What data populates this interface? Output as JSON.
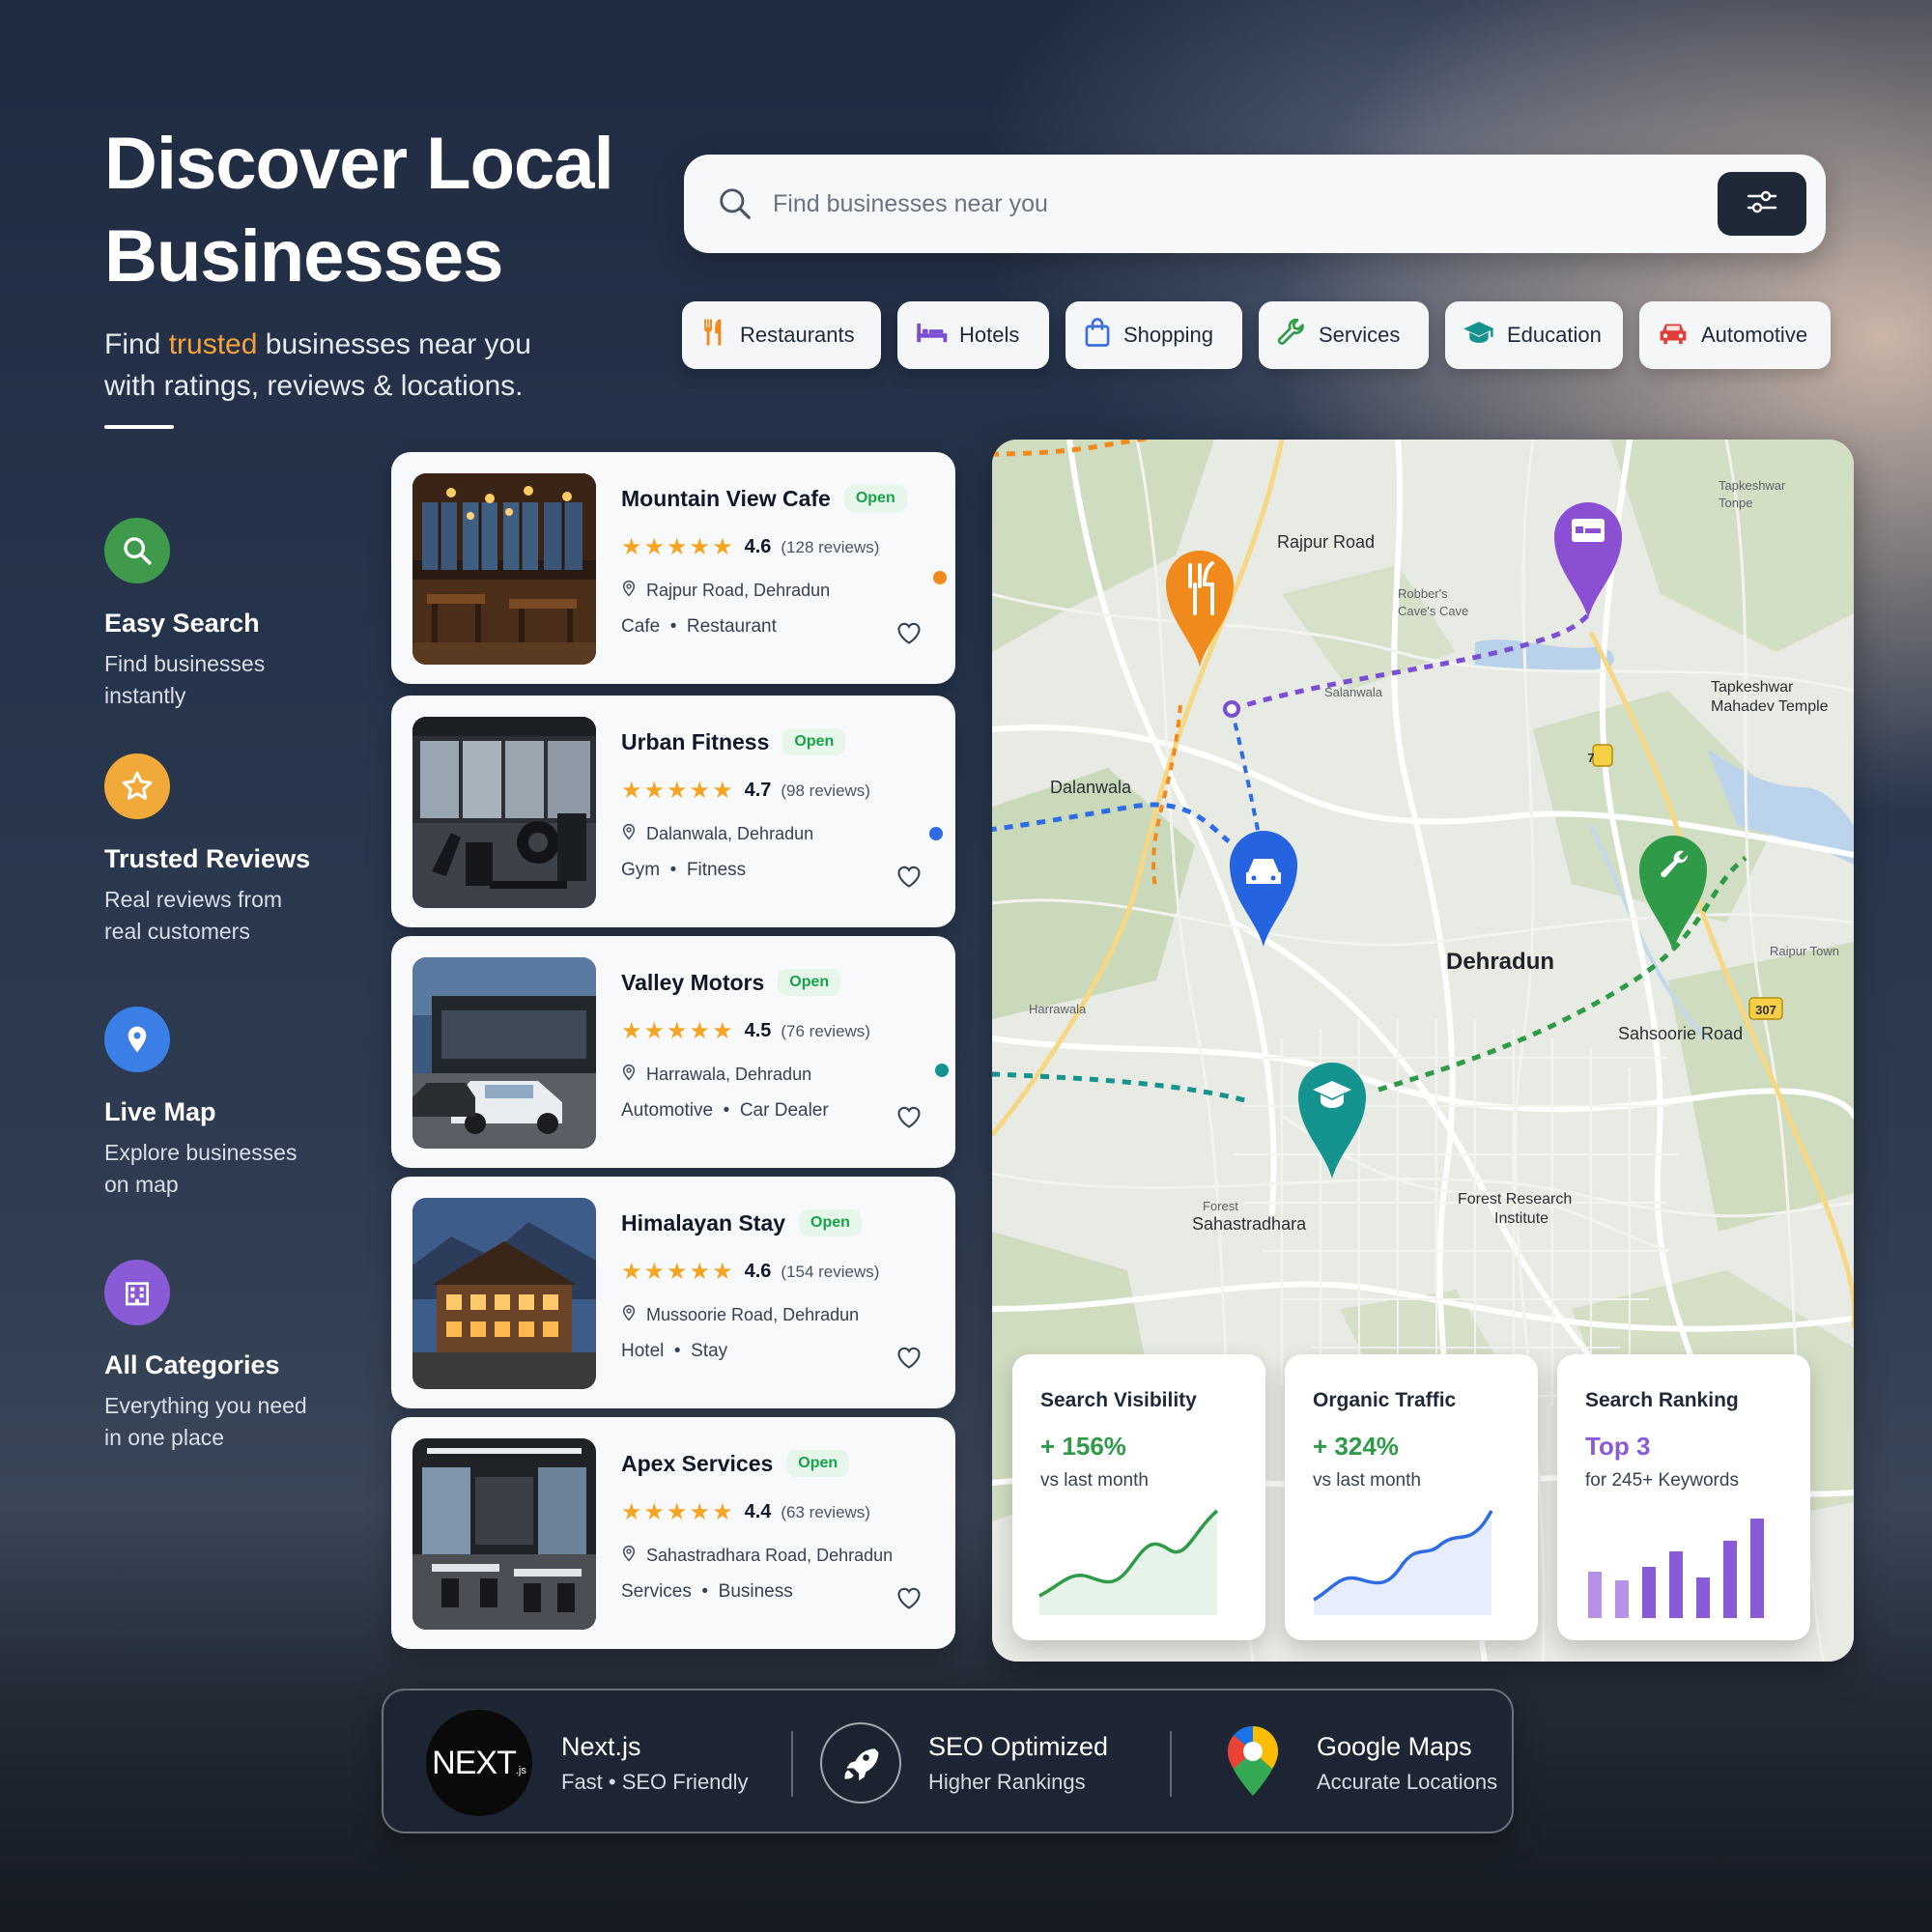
{
  "hero": {
    "title_line1": "Discover Local",
    "title_line2": "Businesses",
    "sub_pre": "Find ",
    "sub_highlight": "trusted",
    "sub_post": " businesses near you",
    "sub_line2": "with ratings, reviews & locations."
  },
  "features": [
    {
      "title": "Easy Search",
      "desc1": "Find businesses",
      "desc2": "instantly",
      "color": "#3f9a4c",
      "icon": "search-icon"
    },
    {
      "title": "Trusted Reviews",
      "desc1": "Real reviews from",
      "desc2": "real customers",
      "color": "#f1a93a",
      "icon": "star-icon"
    },
    {
      "title": "Live Map",
      "desc1": "Explore businesses",
      "desc2": "on map",
      "color": "#3b7fe6",
      "icon": "location-pin-icon"
    },
    {
      "title": "All Categories",
      "desc1": "Everything you need",
      "desc2": "in one place",
      "color": "#8a5bd6",
      "icon": "building-icon"
    }
  ],
  "search": {
    "placeholder": "Find businesses near you"
  },
  "categories": [
    {
      "label": "Restaurants",
      "icon": "fork-knife-icon",
      "color": "#f08a1c"
    },
    {
      "label": "Hotels",
      "icon": "bed-icon",
      "color": "#7b4fd3"
    },
    {
      "label": "Shopping",
      "icon": "shopping-bag-icon",
      "color": "#3b6fe0"
    },
    {
      "label": "Services",
      "icon": "wrench-icon",
      "color": "#2f9a48"
    },
    {
      "label": "Education",
      "icon": "graduation-cap-icon",
      "color": "#14938f"
    },
    {
      "label": "Automotive",
      "icon": "car-icon",
      "color": "#e0403a"
    }
  ],
  "listings": [
    {
      "name": "Mountain View Cafe",
      "status": "Open",
      "stars": "★★★★★",
      "rating": "4.6",
      "reviews": "(128 reviews)",
      "address": "Rajpur Road, Dehradun",
      "tag1": "Cafe",
      "tag2": "Restaurant"
    },
    {
      "name": "Urban Fitness",
      "status": "Open",
      "stars": "★★★★★",
      "rating": "4.7",
      "reviews": "(98 reviews)",
      "address": "Dalanwala, Dehradun",
      "tag1": "Gym",
      "tag2": "Fitness"
    },
    {
      "name": "Valley Motors",
      "status": "Open",
      "stars": "★★★★★",
      "rating": "4.5",
      "reviews": "(76 reviews)",
      "address": "Harrawala, Dehradun",
      "tag1": "Automotive",
      "tag2": "Car Dealer"
    },
    {
      "name": "Himalayan Stay",
      "status": "Open",
      "stars": "★★★★★",
      "rating": "4.6",
      "reviews": "(154 reviews)",
      "address": "Mussoorie Road, Dehradun",
      "tag1": "Hotel",
      "tag2": "Stay"
    },
    {
      "name": "Apex Services",
      "status": "Open",
      "stars": "★★★★★",
      "rating": "4.4",
      "reviews": "(63 reviews)",
      "address": "Sahastradhara Road, Dehradun",
      "tag1": "Services",
      "tag2": "Business"
    }
  ],
  "map": {
    "rajpur": "Rajpur Road",
    "robbers1": "Robber's",
    "robbers2": "Cave's Cave",
    "tapke_top1": "Tapkeshwar",
    "tapke_top2": "Tonpe",
    "tapke1": "Tapkeshwar",
    "tapke2": "Mahadev Temple",
    "salanwala": "Salanwala",
    "dalanwala": "Dalanwala",
    "dehradun": "Dehradun",
    "harrawala": "Harrawala",
    "raipur": "Raipur Town",
    "sahsoorie": "Sahsoorie Road",
    "forest1": "Forest Research",
    "forest2": "Institute",
    "sahastra_small": "Forest",
    "sahastra": "Sahastradhara",
    "badge7": "7",
    "badge307": "307"
  },
  "stats": [
    {
      "label": "Search Visibility",
      "value": "+ 156%",
      "sub": "vs last month",
      "color": "#2f9a48"
    },
    {
      "label": "Organic Traffic",
      "value": "+ 324%",
      "sub": "vs last month",
      "color": "#2f9a48"
    },
    {
      "label": "Search Ranking",
      "value": "Top 3",
      "sub": "for 245+ Keywords",
      "color": "#8a5bd6"
    }
  ],
  "footer": {
    "nextjs_logo": "NEXT",
    "nextjs_logo_sub": ".js",
    "nextjs_title": "Next.js",
    "nextjs_sub": "Fast  •  SEO Friendly",
    "seo_title": "SEO Optimized",
    "seo_sub": "Higher Rankings",
    "maps_title": "Google Maps",
    "maps_sub": "Accurate Locations"
  }
}
